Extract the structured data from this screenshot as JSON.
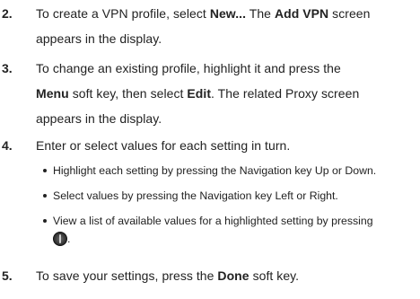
{
  "steps": [
    {
      "number": "2.",
      "line1_pre": "To create a VPN profile, select ",
      "line1_b1": "New...",
      "line1_mid": " The ",
      "line1_b2": "Add VPN",
      "line1_post": " screen",
      "line2": "appears in the display."
    },
    {
      "number": "3.",
      "line1": "To change an existing profile, highlight it and press the",
      "line2_b1": "Menu",
      "line2_mid": " soft key, then select ",
      "line2_b2": "Edit",
      "line2_post": ". The related Proxy screen",
      "line3": "appears in the display."
    },
    {
      "number": "4.",
      "line1": "Enter or select values for each setting in turn.",
      "bullets": [
        "Highlight each setting by pressing the Navigation key Up or Down.",
        "Select values by pressing the Navigation key Left or Right.",
        "View a list of available values for a highlighted setting by pressing"
      ],
      "bullet3_tail": ".",
      "icon": "navigation-key-center-icon"
    },
    {
      "number": "5.",
      "line1_pre": "To save your settings, press the ",
      "line1_b1": "Done",
      "line1_post": " soft key."
    }
  ]
}
